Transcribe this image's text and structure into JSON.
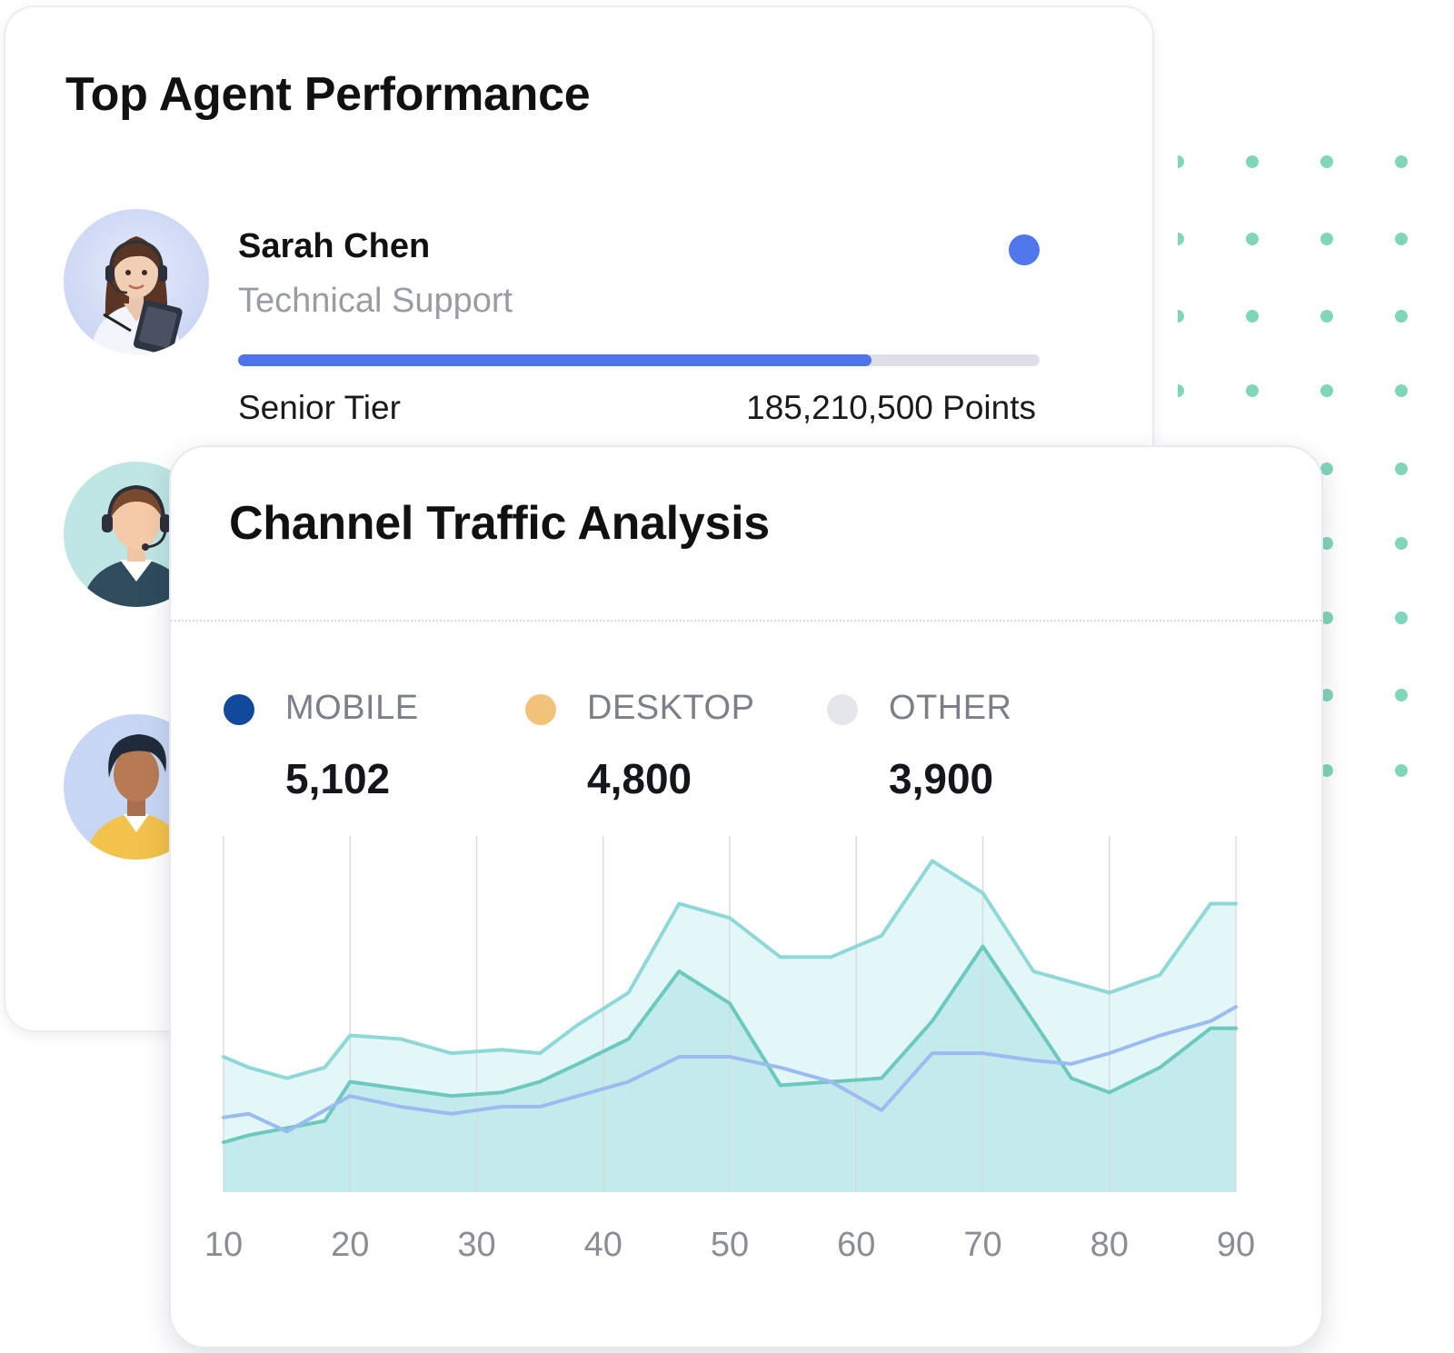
{
  "agent_panel": {
    "title": "Top Agent Performance",
    "agents": [
      {
        "name": "Sarah Chen",
        "department": "Technical Support",
        "tier": "Senior Tier",
        "points": "185,210,500 Points",
        "progress": 0.79,
        "status_color": "#5077ec"
      }
    ]
  },
  "traffic_panel": {
    "title": "Channel Traffic Analysis",
    "legend": [
      {
        "label": "MOBILE",
        "value": "5,102",
        "color": "#13499c"
      },
      {
        "label": "DESKTOP",
        "value": "4,800",
        "color": "#f0c27a"
      },
      {
        "label": "OTHER",
        "value": "3,900",
        "color": "#e5e6ea"
      }
    ]
  },
  "chart_data": {
    "type": "area",
    "x": [
      10,
      12,
      15,
      18,
      20,
      24,
      28,
      32,
      35,
      38,
      42,
      46,
      50,
      54,
      58,
      62,
      66,
      70,
      74,
      77,
      80,
      84,
      88,
      90
    ],
    "xticks": [
      10,
      20,
      30,
      40,
      50,
      60,
      70,
      80,
      90
    ],
    "xlim": [
      10,
      90
    ],
    "ylim": [
      0,
      100
    ],
    "grid": "vertical",
    "series": [
      {
        "values": [
          38,
          35,
          32,
          35,
          44,
          43,
          39,
          40,
          39,
          47,
          56,
          81,
          77,
          66,
          66,
          72,
          93,
          84,
          62,
          59,
          56,
          61,
          81,
          81
        ],
        "color": "#8fd8d8",
        "fill": "#e3f6f8"
      },
      {
        "values": [
          14,
          16,
          18,
          20,
          31,
          29,
          27,
          28,
          31,
          36,
          43,
          62,
          53,
          30,
          31,
          32,
          48,
          69,
          48,
          32,
          28,
          35,
          46,
          46
        ],
        "color": "#6cc9bd",
        "fill": "#c4ebec"
      },
      {
        "values": [
          21,
          22,
          17,
          23,
          27,
          24,
          22,
          24,
          24,
          27,
          31,
          38,
          38,
          35,
          31,
          23,
          39,
          39,
          37,
          36,
          39,
          44,
          48,
          52
        ],
        "color": "#9bbcf0",
        "fill": "none"
      }
    ]
  }
}
